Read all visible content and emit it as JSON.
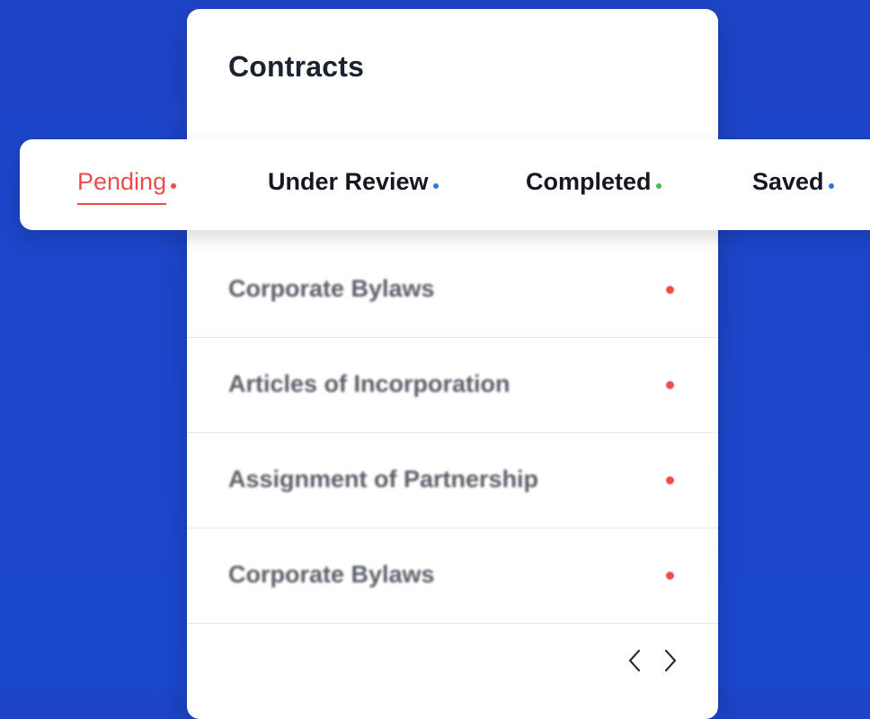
{
  "card": {
    "title": "Contracts"
  },
  "tabs": [
    {
      "label": "Pending",
      "dot_color": "#ee4b4b",
      "active": true
    },
    {
      "label": "Under Review",
      "dot_color": "#2b74e6",
      "active": false
    },
    {
      "label": "Completed",
      "dot_color": "#3cc24b",
      "active": false
    },
    {
      "label": "Saved",
      "dot_color": "#2b74e6",
      "active": false
    }
  ],
  "active_color": "#ee4b4b",
  "rows": [
    {
      "label": "Corporate Bylaws",
      "dot_color": "#ee4b4b"
    },
    {
      "label": "Articles of Incorporation",
      "dot_color": "#ee4b4b"
    },
    {
      "label": "Assignment of Partnership",
      "dot_color": "#ee4b4b"
    },
    {
      "label": "Corporate Bylaws",
      "dot_color": "#ee4b4b"
    }
  ],
  "pager": {
    "prev_icon": "chevron-left-icon",
    "next_icon": "chevron-right-icon"
  }
}
